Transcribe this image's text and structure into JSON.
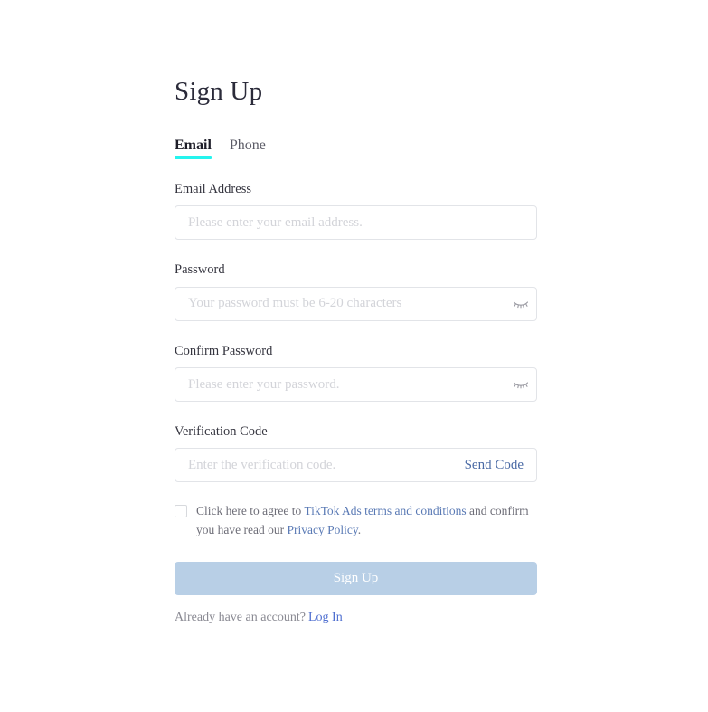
{
  "page": {
    "title": "Sign Up",
    "background": "#ffffff"
  },
  "colors": {
    "tab_accent": "#25f4ee",
    "link_blue": "#5a7ab5",
    "send_code_blue": "#4a6aa5",
    "login_link_blue": "#4f6fd0",
    "submit_disabled_bg": "#b8cfe6",
    "input_border": "#e2e4e8",
    "placeholder": "#d3d4d9"
  },
  "tabs": [
    {
      "label": "Email",
      "active": true
    },
    {
      "label": "Phone",
      "active": false
    }
  ],
  "fields": {
    "email": {
      "label": "Email Address",
      "placeholder": "Please enter your email address.",
      "value": ""
    },
    "password": {
      "label": "Password",
      "placeholder": "Your password must be 6-20 characters",
      "value": "",
      "toggle_icon": "eye-slash-icon"
    },
    "confirm_password": {
      "label": "Confirm Password",
      "placeholder": "Please enter your password.",
      "value": "",
      "toggle_icon": "eye-slash-icon"
    },
    "verification_code": {
      "label": "Verification Code",
      "placeholder": "Enter the verification code.",
      "value": "",
      "send_code_label": "Send Code"
    }
  },
  "agreement": {
    "checked": false,
    "text_part1": "Click here to agree to ",
    "link1": "TikTok Ads terms and conditions",
    "text_part2": " and confirm you have read our ",
    "link2": "Privacy Policy",
    "text_part3": "."
  },
  "submit": {
    "label": "Sign Up",
    "disabled": true
  },
  "footer": {
    "prompt": "Already have an account?",
    "login_label": "Log In"
  }
}
